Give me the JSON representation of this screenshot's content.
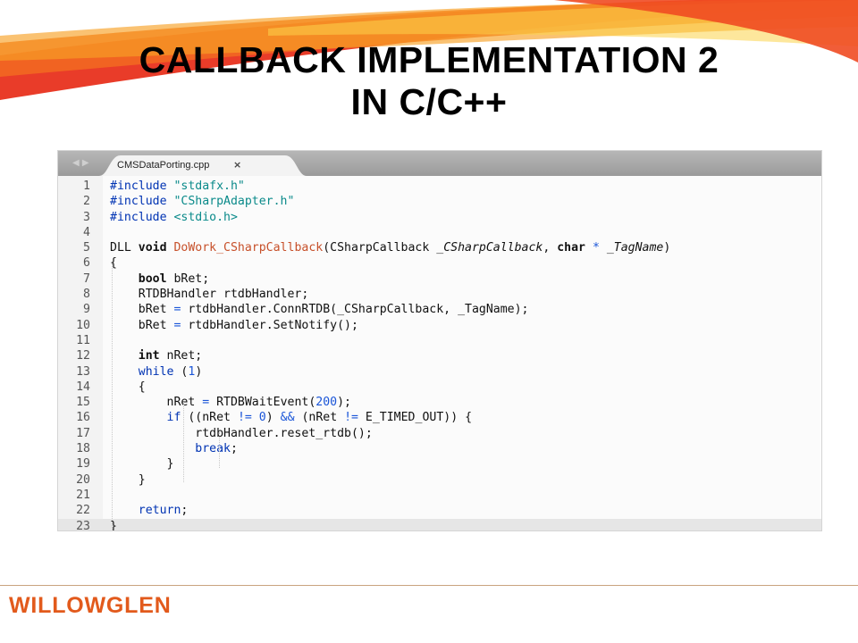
{
  "slide": {
    "title_line1": "CALLBACK IMPLEMENTATION 2",
    "title_line2": "IN C/C++",
    "logo_text": "WILLOWGLEN",
    "accent_colors": [
      "#e8321e",
      "#f58a1f",
      "#fbc02d"
    ]
  },
  "editor": {
    "tab_label": "CMSDataPorting.cpp",
    "tab_close": "×",
    "nav_arrows": "◀ ▶",
    "active_line": 23,
    "lines": [
      {
        "n": "1",
        "t": [
          {
            "c": "kw",
            "s": "#include "
          },
          {
            "c": "str",
            "s": "\"stdafx.h\""
          }
        ]
      },
      {
        "n": "2",
        "t": [
          {
            "c": "kw",
            "s": "#include "
          },
          {
            "c": "str",
            "s": "\"CSharpAdapter.h\""
          }
        ]
      },
      {
        "n": "3",
        "t": [
          {
            "c": "kw",
            "s": "#include "
          },
          {
            "c": "str",
            "s": "<stdio.h>"
          }
        ]
      },
      {
        "n": "4",
        "t": []
      },
      {
        "n": "5",
        "t": [
          {
            "c": "plain",
            "s": "DLL "
          },
          {
            "c": "bold",
            "s": "void "
          },
          {
            "c": "fn",
            "s": "DoWork_CSharpCallback"
          },
          {
            "c": "plain",
            "s": "(CSharpCallback "
          },
          {
            "c": "it",
            "s": "_CSharpCallback"
          },
          {
            "c": "plain",
            "s": ", "
          },
          {
            "c": "bold",
            "s": "char "
          },
          {
            "c": "op",
            "s": "* "
          },
          {
            "c": "it",
            "s": "_TagName"
          },
          {
            "c": "plain",
            "s": ")"
          }
        ]
      },
      {
        "n": "6",
        "t": [
          {
            "c": "plain",
            "s": "{"
          }
        ]
      },
      {
        "n": "7",
        "t": [
          {
            "c": "plain",
            "s": "    "
          },
          {
            "c": "bold",
            "s": "bool "
          },
          {
            "c": "plain",
            "s": "bRet;"
          }
        ]
      },
      {
        "n": "8",
        "t": [
          {
            "c": "plain",
            "s": "    RTDBHandler rtdbHandler;"
          }
        ]
      },
      {
        "n": "9",
        "t": [
          {
            "c": "plain",
            "s": "    bRet "
          },
          {
            "c": "op",
            "s": "="
          },
          {
            "c": "plain",
            "s": " rtdbHandler.ConnRTDB(_CSharpCallback, _TagName);"
          }
        ]
      },
      {
        "n": "10",
        "t": [
          {
            "c": "plain",
            "s": "    bRet "
          },
          {
            "c": "op",
            "s": "="
          },
          {
            "c": "plain",
            "s": " rtdbHandler.SetNotify();"
          }
        ]
      },
      {
        "n": "11",
        "t": []
      },
      {
        "n": "12",
        "t": [
          {
            "c": "plain",
            "s": "    "
          },
          {
            "c": "bold",
            "s": "int "
          },
          {
            "c": "plain",
            "s": "nRet;"
          }
        ]
      },
      {
        "n": "13",
        "t": [
          {
            "c": "plain",
            "s": "    "
          },
          {
            "c": "kw",
            "s": "while "
          },
          {
            "c": "plain",
            "s": "("
          },
          {
            "c": "num",
            "s": "1"
          },
          {
            "c": "plain",
            "s": ")"
          }
        ]
      },
      {
        "n": "14",
        "t": [
          {
            "c": "plain",
            "s": "    {"
          }
        ]
      },
      {
        "n": "15",
        "t": [
          {
            "c": "plain",
            "s": "        nRet "
          },
          {
            "c": "op",
            "s": "="
          },
          {
            "c": "plain",
            "s": " RTDBWaitEvent("
          },
          {
            "c": "num",
            "s": "200"
          },
          {
            "c": "plain",
            "s": ");"
          }
        ]
      },
      {
        "n": "16",
        "t": [
          {
            "c": "plain",
            "s": "        "
          },
          {
            "c": "kw",
            "s": "if "
          },
          {
            "c": "plain",
            "s": "((nRet "
          },
          {
            "c": "op",
            "s": "!="
          },
          {
            "c": "plain",
            "s": " "
          },
          {
            "c": "num",
            "s": "0"
          },
          {
            "c": "plain",
            "s": ") "
          },
          {
            "c": "op",
            "s": "&&"
          },
          {
            "c": "plain",
            "s": " (nRet "
          },
          {
            "c": "op",
            "s": "!="
          },
          {
            "c": "plain",
            "s": " E_TIMED_OUT)) {"
          }
        ]
      },
      {
        "n": "17",
        "t": [
          {
            "c": "plain",
            "s": "            rtdbHandler.reset_rtdb();"
          }
        ]
      },
      {
        "n": "18",
        "t": [
          {
            "c": "plain",
            "s": "            "
          },
          {
            "c": "kw",
            "s": "break"
          },
          {
            "c": "plain",
            "s": ";"
          }
        ]
      },
      {
        "n": "19",
        "t": [
          {
            "c": "plain",
            "s": "        }"
          }
        ]
      },
      {
        "n": "20",
        "t": [
          {
            "c": "plain",
            "s": "    }"
          }
        ]
      },
      {
        "n": "21",
        "t": []
      },
      {
        "n": "22",
        "t": [
          {
            "c": "plain",
            "s": "    "
          },
          {
            "c": "kw",
            "s": "return"
          },
          {
            "c": "plain",
            "s": ";"
          }
        ]
      },
      {
        "n": "23",
        "t": [
          {
            "c": "plain",
            "s": "}"
          }
        ]
      }
    ]
  }
}
